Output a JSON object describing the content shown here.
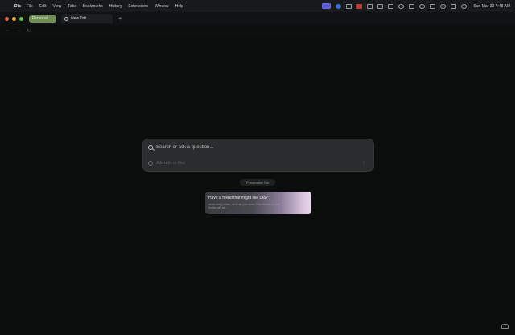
{
  "menubar": {
    "app_name": "Dia",
    "items": [
      "File",
      "Edit",
      "View",
      "Tabs",
      "Bookmarks",
      "History",
      "Extensions",
      "Window",
      "Help"
    ],
    "datetime": "Sun Mar 30  7:48 AM"
  },
  "tabstrip": {
    "profile_label": "Personal",
    "tab_title": "New Tab"
  },
  "search": {
    "placeholder": "Search or ask a question...",
    "add_tabs_label": "Add tabs or files"
  },
  "personalize_label": "Personalize Dia",
  "promo": {
    "title": "Have a friend that might like Dia?",
    "body": "As an early tester, we trust your taste. Pick friends & Dia invites will be..."
  }
}
